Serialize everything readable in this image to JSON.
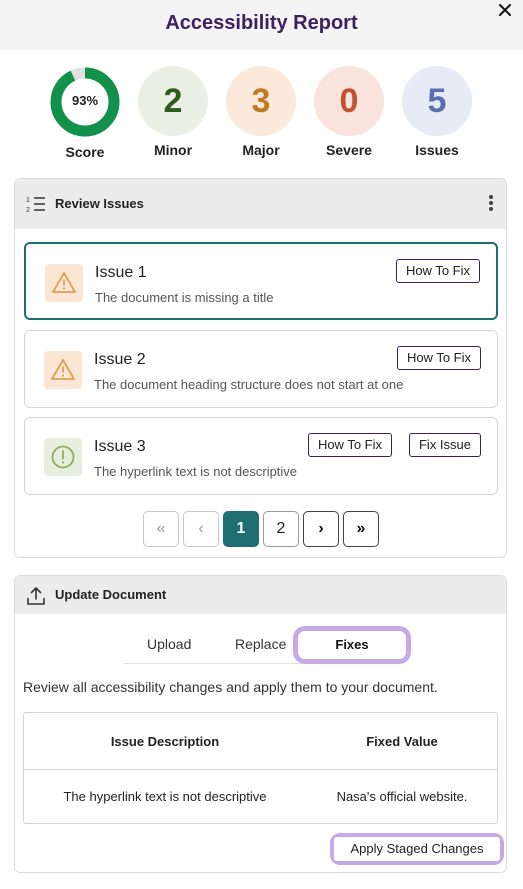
{
  "header": {
    "title": "Accessibility Report",
    "close_icon": "close-icon"
  },
  "stats": {
    "score": {
      "value": "93%",
      "label": "Score",
      "fraction": 0.93,
      "color": "#12914a"
    },
    "minor": {
      "value": "2",
      "label": "Minor",
      "color": "#2e5b1e",
      "bg": "#eaf1e4"
    },
    "major": {
      "value": "3",
      "label": "Major",
      "color": "#c27a22",
      "bg": "#fbeadb"
    },
    "severe": {
      "value": "0",
      "label": "Severe",
      "color": "#c4512f",
      "bg": "#fbe3dd"
    },
    "issues": {
      "value": "5",
      "label": "Issues",
      "color": "#5b6fb0",
      "bg": "#e7ebf6"
    }
  },
  "review": {
    "title": "Review Issues",
    "icon": "numbered-list-icon",
    "issues": [
      {
        "title": "Issue 1",
        "desc": "The document is missing a title",
        "type": "warning",
        "how_to_fix": "How To Fix"
      },
      {
        "title": "Issue 2",
        "desc": "The document heading structure does not start at one",
        "type": "warning",
        "how_to_fix": "How To Fix"
      },
      {
        "title": "Issue 3",
        "desc": "The hyperlink text is not descriptive",
        "type": "info",
        "how_to_fix": "How To Fix",
        "fix_issue": "Fix Issue"
      }
    ],
    "pagination": {
      "first": "«",
      "prev": "‹",
      "pages": [
        "1",
        "2"
      ],
      "current": "1",
      "next": "›",
      "last": "»"
    }
  },
  "update": {
    "title": "Update Document",
    "icon": "upload-icon",
    "tabs": [
      "Upload",
      "Replace",
      "Fixes"
    ],
    "active_tab": "Fixes",
    "help_text": "Review all accessibility changes and apply them to your document.",
    "table": {
      "headers": [
        "Issue Description",
        "Fixed Value"
      ],
      "rows": [
        [
          "The hyperlink text is not descriptive",
          "Nasa's official website."
        ]
      ]
    },
    "apply_label": "Apply Staged Changes"
  }
}
